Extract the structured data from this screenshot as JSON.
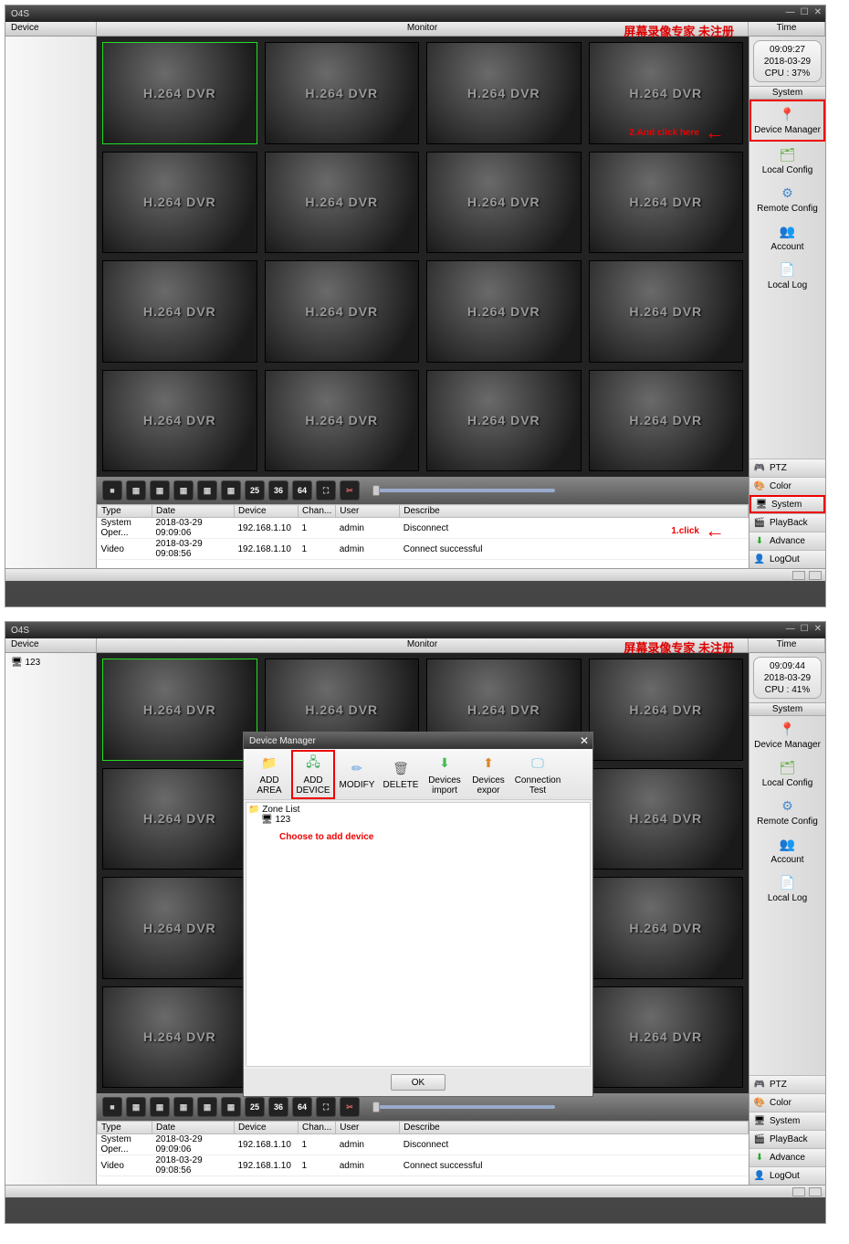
{
  "app_title": "O4S",
  "watermark": "屏幕录像专家 未注册",
  "header": {
    "device": "Device",
    "monitor": "Monitor",
    "time": "Time"
  },
  "screenshot1": {
    "time": {
      "clock": "09:09:27",
      "date": "2018-03-29",
      "cpu": "CPU : 37%"
    },
    "tile_label": "H.264 DVR",
    "grid_nums": [
      "25",
      "36",
      "64"
    ],
    "log_cols": [
      "Type",
      "Date",
      "Device",
      "Chan...",
      "User",
      "Describe"
    ],
    "log_rows": [
      [
        "System Oper...",
        "2018-03-29 09:09:06",
        "192.168.1.10",
        "1",
        "admin",
        "Disconnect"
      ],
      [
        "Video",
        "2018-03-29 09:08:56",
        "192.168.1.10",
        "1",
        "admin",
        "Connect successful"
      ]
    ],
    "system_section": "System",
    "sys_items": [
      "Device Manager",
      "Local Config",
      "Remote Config",
      "Account",
      "Local Log"
    ],
    "accordion": [
      "PTZ",
      "Color",
      "System",
      "PlayBack",
      "Advance",
      "LogOut"
    ],
    "annot1": "1.click",
    "annot2": "2.And click here"
  },
  "screenshot2": {
    "time": {
      "clock": "09:09:44",
      "date": "2018-03-29",
      "cpu": "CPU : 41%"
    },
    "tile_label": "H.264 DVR",
    "tree_root": "123",
    "system_section": "System",
    "sys_items": [
      "Device Manager",
      "Local Config",
      "Remote Config",
      "Account",
      "Local Log"
    ],
    "accordion": [
      "PTZ",
      "Color",
      "System",
      "PlayBack",
      "Advance",
      "LogOut"
    ],
    "dialog": {
      "title": "Device Manager",
      "tools": [
        "ADD AREA",
        "ADD DEVICE",
        "MODIFY",
        "DELETE",
        "Devices import",
        "Devices expor",
        "Connection Test"
      ],
      "tree": [
        "Zone List",
        "123"
      ],
      "ok": "OK"
    },
    "annot": "Choose to add device",
    "log_cols": [
      "Type",
      "Date",
      "Device",
      "Chan...",
      "User",
      "Describe"
    ],
    "log_rows": [
      [
        "System Oper...",
        "2018-03-29 09:09:06",
        "192.168.1.10",
        "1",
        "admin",
        "Disconnect"
      ],
      [
        "Video",
        "2018-03-29 09:08:56",
        "192.168.1.10",
        "1",
        "admin",
        "Connect successful"
      ]
    ]
  },
  "colors": {
    "accent_red": "#e00",
    "device_mgr": "#d22",
    "local_cfg": "#6a4",
    "remote_cfg": "#48c",
    "account": "#28c",
    "local_log": "#cc8"
  }
}
